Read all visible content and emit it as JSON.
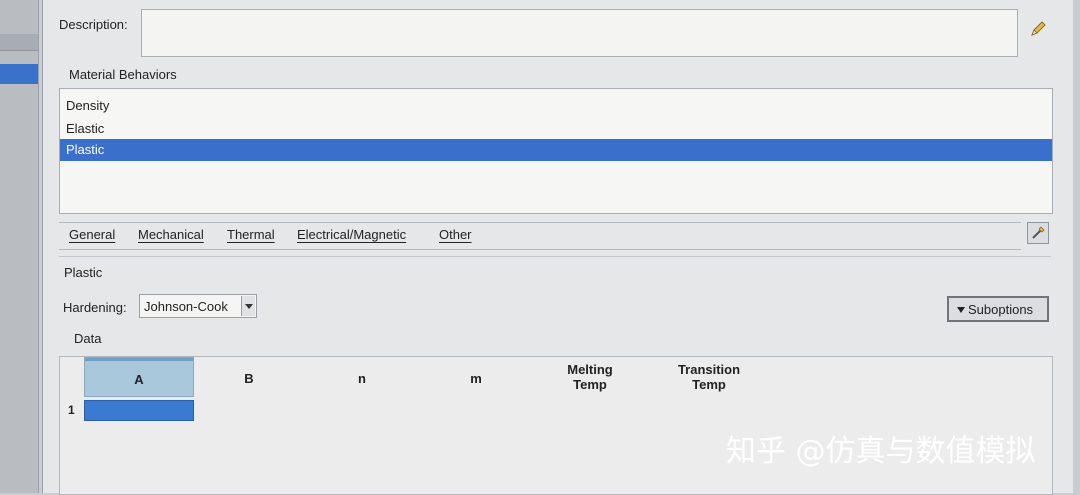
{
  "description": {
    "label": "Description:",
    "value": ""
  },
  "behaviors": {
    "title": "Material Behaviors",
    "items": [
      {
        "label": "Density",
        "selected": false
      },
      {
        "label": "Elastic",
        "selected": false
      },
      {
        "label": "Plastic",
        "selected": true
      }
    ]
  },
  "menu": {
    "items": [
      "General",
      "Mechanical",
      "Thermal",
      "Electrical/Magnetic",
      "Other"
    ]
  },
  "plastic": {
    "section_title": "Plastic",
    "hardening_label": "Hardening:",
    "hardening_value": "Johnson-Cook",
    "suboptions_label": "Suboptions"
  },
  "data_table": {
    "title": "Data",
    "columns": [
      {
        "line1": "A",
        "line2": ""
      },
      {
        "line1": "B",
        "line2": ""
      },
      {
        "line1": "n",
        "line2": ""
      },
      {
        "line1": "m",
        "line2": ""
      },
      {
        "line1": "Melting",
        "line2": "Temp"
      },
      {
        "line1": "Transition",
        "line2": "Temp"
      }
    ],
    "rows": [
      {
        "index": "1",
        "cells": [
          "",
          "",
          "",
          "",
          "",
          ""
        ]
      }
    ]
  },
  "watermark": "知乎 @仿真与数值模拟",
  "colors": {
    "selection": "#3a6fcb",
    "header_selected": "#a9c8dc"
  }
}
